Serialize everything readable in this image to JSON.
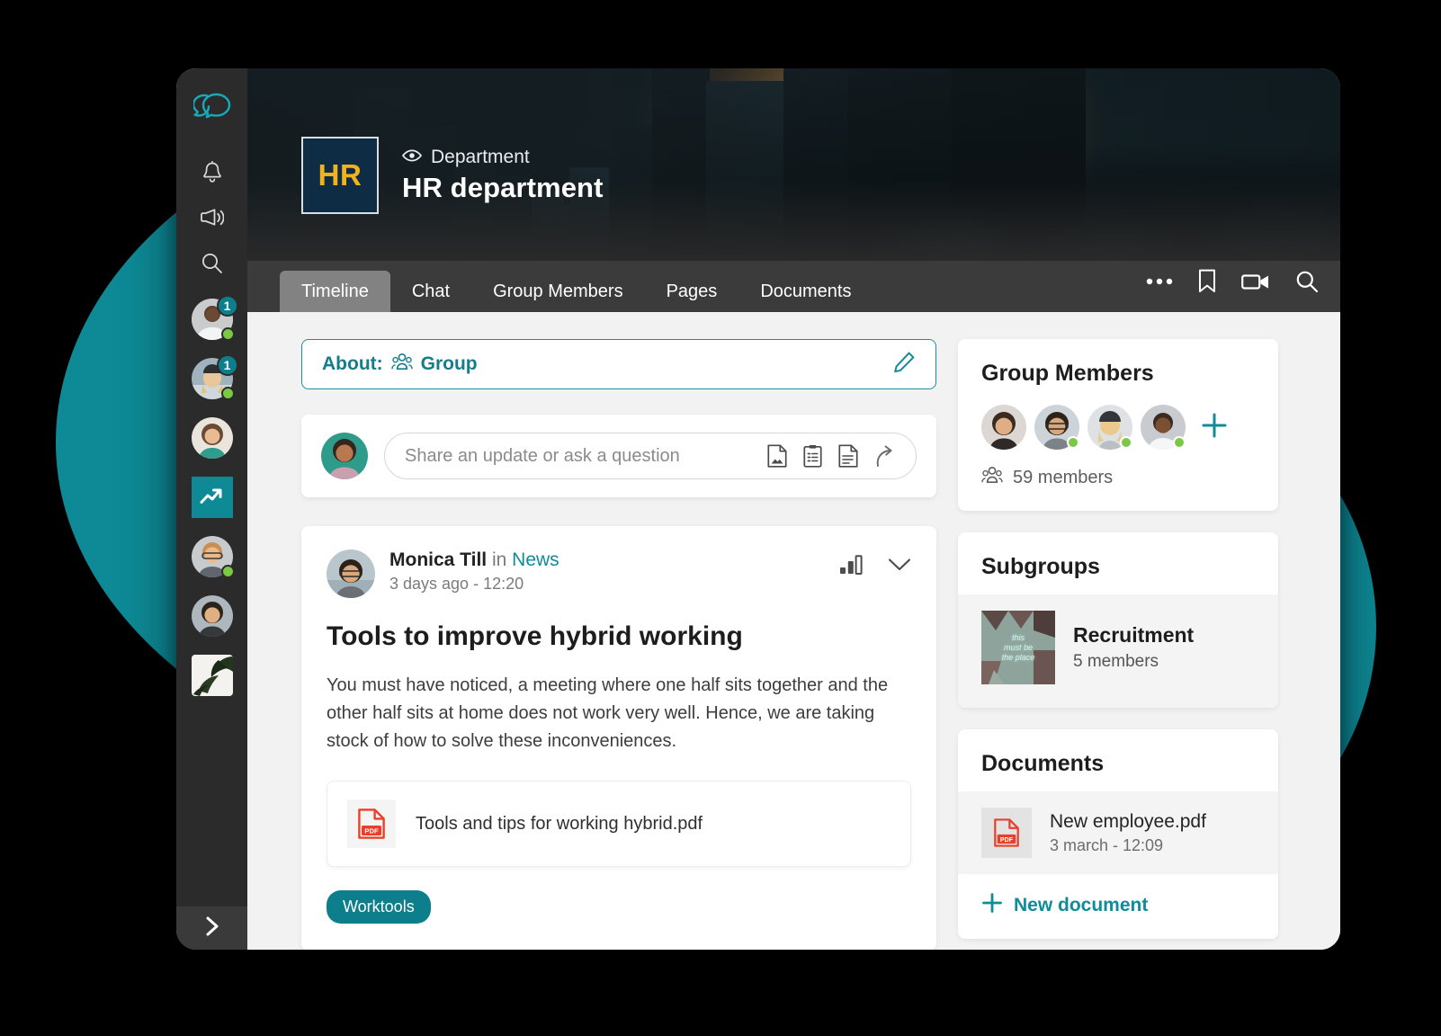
{
  "theme": {
    "accent": "#0d8a96",
    "accent_dark": "#0d7f8c",
    "rail_bg": "#2b2b2b",
    "tabbar_bg": "#3b3b3b",
    "page_bg": "#f2f2f2",
    "online": "#7ac943",
    "badge_bg": "#0d7f8c",
    "hr_tile_bg": "#0e2d45",
    "hr_tile_text": "#f2b21c"
  },
  "rail": {
    "logo_icon": "speech-bubbles-logo-icon",
    "icons": [
      {
        "name": "bell-icon",
        "label": "Notifications"
      },
      {
        "name": "megaphone-icon",
        "label": "Announcements"
      },
      {
        "name": "search-icon",
        "label": "Search"
      }
    ],
    "items": [
      {
        "name": "rail-avatar-1",
        "type": "avatar",
        "badge": "1",
        "online": true
      },
      {
        "name": "rail-avatar-2",
        "type": "avatar",
        "badge": "1",
        "online": true
      },
      {
        "name": "rail-avatar-3",
        "type": "avatar",
        "badge": "",
        "online": false
      },
      {
        "name": "rail-tile-trending",
        "type": "tile",
        "icon": "trending-up-icon"
      },
      {
        "name": "rail-avatar-4",
        "type": "avatar",
        "badge": "",
        "online": true
      },
      {
        "name": "rail-avatar-5",
        "type": "avatar",
        "badge": "",
        "online": false
      },
      {
        "name": "rail-thumb-plant",
        "type": "thumb",
        "badge": "",
        "online": false
      }
    ],
    "expand_icon": "chevron-right-icon"
  },
  "banner": {
    "avatar_initials": "HR",
    "eye_icon": "eye-icon",
    "kind_label": "Department",
    "title": "HR department"
  },
  "tabbar": {
    "tabs": [
      {
        "label": "Timeline",
        "active": true
      },
      {
        "label": "Chat",
        "active": false
      },
      {
        "label": "Group Members",
        "active": false
      },
      {
        "label": "Pages",
        "active": false
      },
      {
        "label": "Documents",
        "active": false
      }
    ],
    "actions": [
      {
        "name": "more-options-icon",
        "label": "More"
      },
      {
        "name": "bookmark-icon",
        "label": "Bookmark"
      },
      {
        "name": "video-camera-icon",
        "label": "Video"
      },
      {
        "name": "search-icon",
        "label": "Search"
      }
    ]
  },
  "about": {
    "prefix": "About:",
    "group_icon": "group-people-icon",
    "value": "Group",
    "edit_icon": "pencil-edit-icon"
  },
  "composer": {
    "placeholder": "Share an update or ask a question",
    "icons": [
      {
        "name": "image-file-icon",
        "label": "Add image"
      },
      {
        "name": "clipboard-poll-icon",
        "label": "Add poll"
      },
      {
        "name": "document-file-icon",
        "label": "Add document"
      },
      {
        "name": "share-arrow-icon",
        "label": "Share"
      }
    ]
  },
  "post": {
    "author": "Monica Till",
    "in_word": " in ",
    "channel": "News",
    "timestamp": "3 days ago - 12:20",
    "stats_icon": "bar-chart-stats-icon",
    "chevron_icon": "chevron-down-icon",
    "title": "Tools to improve hybrid working",
    "body": "You must have noticed, a meeting where one half sits together and the other half sits at home does not work very well. Hence, we are taking stock of how to solve these inconveniences.",
    "attachment": {
      "icon": "pdf-file-icon",
      "name": "Tools and tips for working hybrid.pdf"
    },
    "tag": "Worktools"
  },
  "sidebar": {
    "members_panel": {
      "title": "Group Members",
      "avatars": [
        {
          "name": "member-avatar-1",
          "online": false
        },
        {
          "name": "member-avatar-2",
          "online": true
        },
        {
          "name": "member-avatar-3",
          "online": true
        },
        {
          "name": "member-avatar-4",
          "online": true
        }
      ],
      "add_icon": "plus-icon",
      "count_icon": "group-people-icon",
      "count_label": "59 members"
    },
    "subgroups_panel": {
      "title": "Subgroups",
      "items": [
        {
          "name": "Recruitment",
          "members": "5 members",
          "thumb_text": [
            "this",
            "must be",
            "the place"
          ]
        }
      ]
    },
    "documents_panel": {
      "title": "Documents",
      "items": [
        {
          "icon": "pdf-file-icon",
          "name": "New employee.pdf",
          "time": "3 march - 12:09"
        }
      ],
      "new_icon": "plus-icon",
      "new_label": "New document"
    }
  }
}
